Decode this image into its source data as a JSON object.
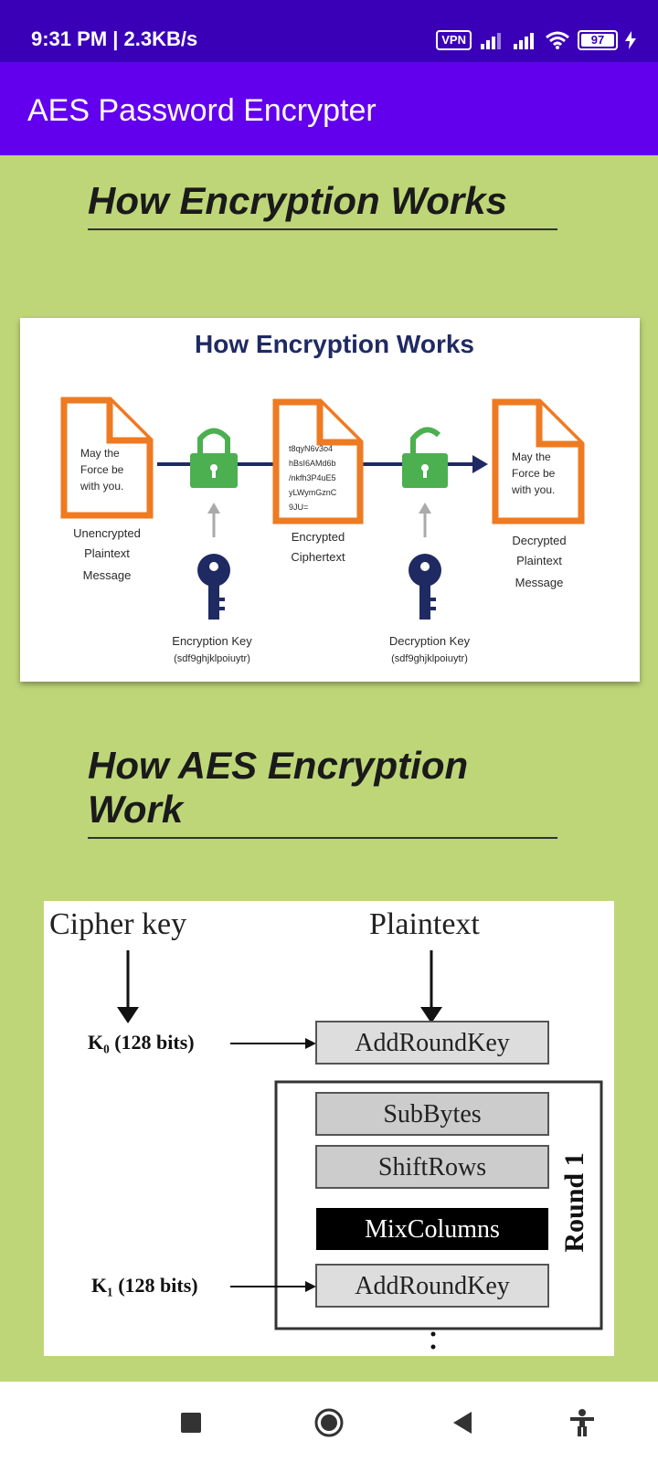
{
  "status": {
    "time": "9:31 PM | 2.3KB/s",
    "vpn": "VPN",
    "battery": "97"
  },
  "app": {
    "title": "AES Password Encrypter"
  },
  "section1": {
    "title": "How Encryption Works"
  },
  "diagram1": {
    "title": "How Encryption Works",
    "plaintext_lines": [
      "May the",
      "Force be",
      "with you."
    ],
    "cipher_lines": [
      "t8qyN6v3o4",
      "hBsI6AMd6b",
      "/nkfh3P4uE5",
      "yLWymGznC",
      "9JU="
    ],
    "unencrypted_lines": [
      "Unencrypted",
      "Plaintext",
      "Message"
    ],
    "encrypted_lines": [
      "Encrypted",
      "Ciphertext"
    ],
    "decrypted_lines": [
      "Decrypted",
      "Plaintext",
      "Message"
    ],
    "enc_key": "Encryption Key",
    "enc_key_val": "(sdf9ghjklpoiuytr)",
    "dec_key": "Decryption Key",
    "dec_key_val": "(sdf9ghjklpoiuytr)",
    "colors": {
      "doc": "#ee7a22",
      "lock": "#4caf50",
      "navy": "#1f2a63"
    }
  },
  "section2": {
    "title": "How AES Encryption Work"
  },
  "diagram2": {
    "cipher_key": "Cipher key",
    "plaintext": "Plaintext",
    "k0": "K₀ (128 bits)",
    "k1": "K₁ (128 bits)",
    "add_round_key": "AddRoundKey",
    "sub_bytes": "SubBytes",
    "shift_rows": "ShiftRows",
    "mix_columns": "MixColumns",
    "add_round_key_2": "AddRoundKey",
    "round": "Round 1"
  },
  "nav": {
    "icons": [
      "recent-apps-icon",
      "home-icon",
      "back-icon",
      "accessibility-icon"
    ]
  }
}
